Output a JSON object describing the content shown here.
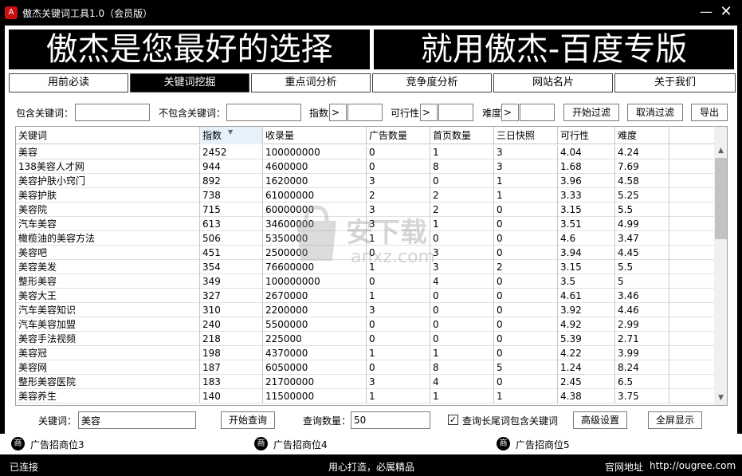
{
  "window": {
    "title": "傲杰关键词工具1.0（会员版）",
    "app_icon_glyph": "A",
    "minimize_glyph": "—",
    "close_glyph": "✕"
  },
  "banner": {
    "left": "傲杰是您最好的选择",
    "right": "就用傲杰-百度专版"
  },
  "tabs": [
    {
      "label": "用前必读",
      "active": false
    },
    {
      "label": "关键词挖掘",
      "active": true
    },
    {
      "label": "重点词分析",
      "active": false
    },
    {
      "label": "竞争度分析",
      "active": false
    },
    {
      "label": "网站名片",
      "active": false
    },
    {
      "label": "关于我们",
      "active": false
    }
  ],
  "filter": {
    "include_label": "包含关键词：",
    "include_value": "",
    "exclude_label": "不包含关键词：",
    "exclude_value": "",
    "index_label": "指数",
    "index_op": ">",
    "index_value": "",
    "feasibility_label": "可行性",
    "feasibility_op": ">",
    "feasibility_value": "",
    "difficulty_label": "难度",
    "difficulty_op": ">",
    "difficulty_value": "",
    "apply_button": "开始过滤",
    "cancel_button": "取消过滤",
    "export_button": "导出"
  },
  "table": {
    "columns": [
      "关键词",
      "指数",
      "收录量",
      "广告数量",
      "首页数量",
      "三日快照",
      "可行性",
      "难度"
    ],
    "sorted_column": "指数",
    "rows": [
      [
        "美容",
        "2452",
        "100000000",
        "0",
        "1",
        "3",
        "4.04",
        "4.24"
      ],
      [
        "138美容人才网",
        "944",
        "4600000",
        "0",
        "8",
        "3",
        "1.68",
        "7.69"
      ],
      [
        "美容护肤小窍门",
        "892",
        "1620000",
        "3",
        "0",
        "1",
        "3.96",
        "4.58"
      ],
      [
        "美容护肤",
        "738",
        "61000000",
        "2",
        "2",
        "1",
        "3.33",
        "5.25"
      ],
      [
        "美容院",
        "715",
        "60000000",
        "3",
        "2",
        "0",
        "3.15",
        "5.5"
      ],
      [
        "汽车美容",
        "613",
        "34600000",
        "3",
        "1",
        "0",
        "3.51",
        "4.99"
      ],
      [
        "橄榄油的美容方法",
        "506",
        "5350000",
        "1",
        "0",
        "0",
        "4.6",
        "3.47"
      ],
      [
        "美容吧",
        "451",
        "2500000",
        "0",
        "3",
        "0",
        "3.94",
        "4.45"
      ],
      [
        "美容美发",
        "354",
        "76600000",
        "1",
        "3",
        "2",
        "3.15",
        "5.5"
      ],
      [
        "整形美容",
        "349",
        "100000000",
        "0",
        "4",
        "0",
        "3.5",
        "5"
      ],
      [
        "美容大王",
        "327",
        "2670000",
        "1",
        "0",
        "0",
        "4.61",
        "3.46"
      ],
      [
        "汽车美容知识",
        "310",
        "2200000",
        "3",
        "0",
        "0",
        "3.92",
        "4.46"
      ],
      [
        "汽车美容加盟",
        "240",
        "5500000",
        "0",
        "0",
        "0",
        "4.92",
        "2.99"
      ],
      [
        "美容手法视频",
        "218",
        "225000",
        "0",
        "0",
        "0",
        "5.39",
        "2.71"
      ],
      [
        "美容冠",
        "198",
        "4370000",
        "1",
        "1",
        "0",
        "4.22",
        "3.99"
      ],
      [
        "美容网",
        "187",
        "6050000",
        "0",
        "8",
        "5",
        "1.24",
        "8.24"
      ],
      [
        "整形美容医院",
        "183",
        "21700000",
        "3",
        "4",
        "0",
        "2.45",
        "6.5"
      ],
      [
        "美容养生",
        "140",
        "11500000",
        "1",
        "1",
        "1",
        "4.38",
        "3.75"
      ]
    ]
  },
  "watermark": {
    "title": "安下载",
    "subtitle": "anxz.com"
  },
  "query": {
    "keyword_label": "关键词：",
    "keyword_value": "美容",
    "start_button": "开始查询",
    "count_label": "查询数量：",
    "count_value": "50",
    "checkbox_checked": true,
    "checkbox_label": "查询长尾词包含关键词",
    "advanced_button": "高级设置",
    "fullscreen_button": "全屏显示"
  },
  "ads": [
    {
      "icon": "商",
      "label": "广告招商位3"
    },
    {
      "icon": "商",
      "label": "广告招商位4"
    },
    {
      "icon": "商",
      "label": "广告招商位5"
    }
  ],
  "status": {
    "connection": "已连接",
    "slogan": "用心打造，必属精品",
    "website_label": "官网地址",
    "website_url": "http://ougree.com"
  }
}
